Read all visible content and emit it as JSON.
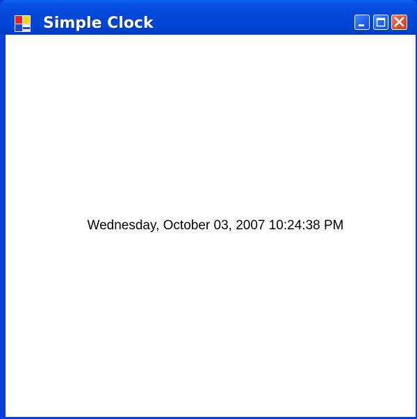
{
  "window": {
    "title": "Simple Clock",
    "accent": "#0046d6"
  },
  "titlebar": {
    "icon": "app-window-icon",
    "buttons": [
      {
        "name": "minimize",
        "icon": "minimize-icon"
      },
      {
        "name": "maximize",
        "icon": "maximize-icon"
      },
      {
        "name": "close",
        "icon": "close-icon",
        "color": "#e0502c"
      }
    ]
  },
  "clock": {
    "datetime": "Wednesday, October 03, 2007 10:24:38 PM"
  }
}
